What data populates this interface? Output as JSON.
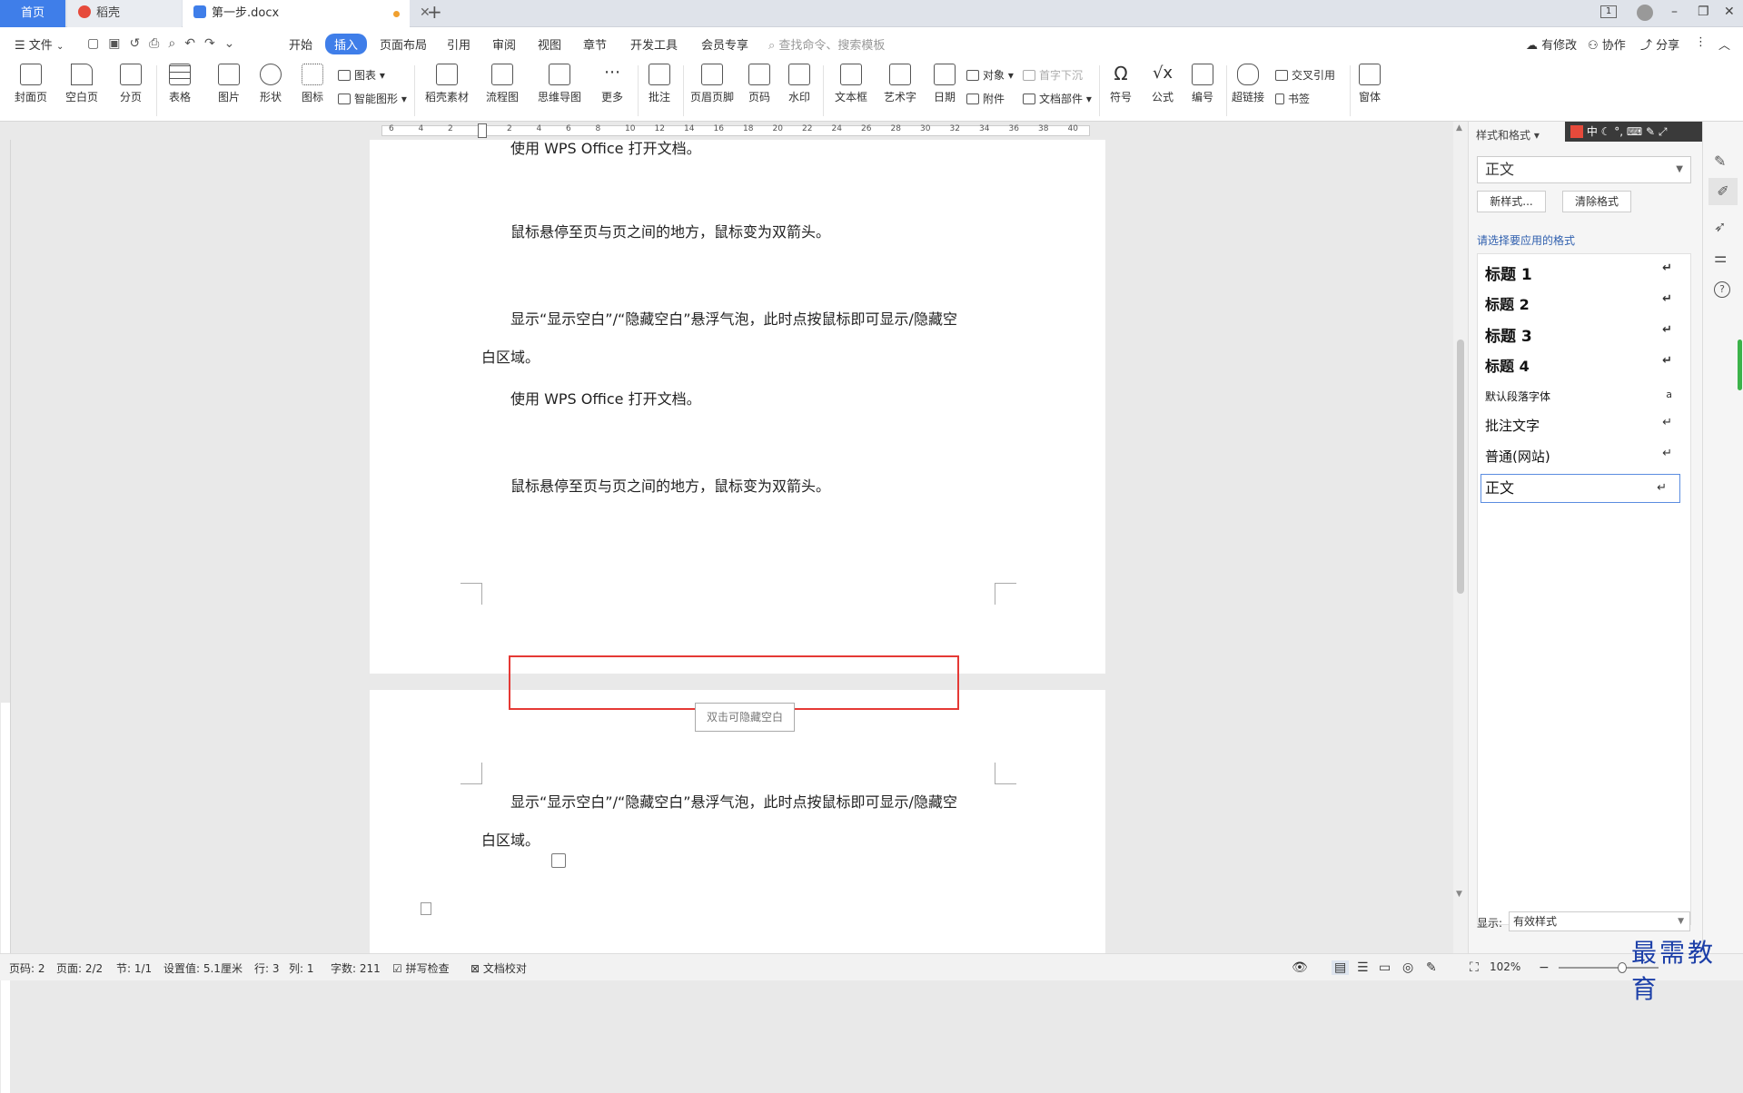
{
  "tabs": {
    "home": "首页",
    "daoke": "稻壳",
    "doc": "第一步.docx",
    "new_tab": "+"
  },
  "window": {
    "layout_btn": "1",
    "minimize": "–",
    "restore": "❐",
    "close": "✕"
  },
  "menu": {
    "file": "文件",
    "items": [
      "开始",
      "插入",
      "页面布局",
      "引用",
      "审阅",
      "视图",
      "章节",
      "开发工具",
      "会员专享"
    ],
    "search_placeholder": "查找命令、搜索模板",
    "modify": "有修改",
    "collab": "协作",
    "share": "分享"
  },
  "ribbon": {
    "big": [
      "封面页",
      "空白页",
      "分页",
      "表格",
      "图片",
      "形状",
      "图标",
      "稻壳素材",
      "流程图",
      "思维导图",
      "更多",
      "批注",
      "页眉页脚",
      "页码",
      "水印",
      "文本框",
      "艺术字",
      "日期",
      "符号",
      "公式",
      "编号",
      "超链接",
      "窗体"
    ],
    "small": {
      "chart": "图表",
      "smart": "智能图形",
      "object": "对象",
      "attach": "附件",
      "dropcap": "首字下沉",
      "docpart": "文档部件",
      "crossref": "交叉引用",
      "bookmark": "书签"
    }
  },
  "ruler_ticks": [
    "6",
    "4",
    "2",
    "",
    "2",
    "4",
    "6",
    "8",
    "10",
    "12",
    "14",
    "16",
    "18",
    "20",
    "22",
    "24",
    "26",
    "28",
    "30",
    "32",
    "34",
    "36",
    "38",
    "40"
  ],
  "doc": {
    "p0": "使用 WPS Office 打开文档。",
    "p1": "鼠标悬停至页与页之间的地方，鼠标变为双箭头。",
    "p2a": "显示“显示空白”/“隐藏空白”悬浮气泡，此时点按鼠标即可显示/隐藏空",
    "p2b": "白区域。",
    "p3": "使用 WPS Office 打开文档。",
    "p4": "鼠标悬停至页与页之间的地方，鼠标变为双箭头。",
    "tooltip": "双击可隐藏空白",
    "p5a": "显示“显示空白”/“隐藏空白”悬浮气泡，此时点按鼠标即可显示/隐藏空",
    "p5b": "白区域。"
  },
  "panel": {
    "title": "样式和格式",
    "current": "正文",
    "new_style": "新样式...",
    "clear_format": "清除格式",
    "hint": "请选择要应用的格式",
    "styles": [
      "标题  1",
      "标题  2",
      "标题  3",
      "标题  4",
      "默认段落字体",
      "批注文字",
      "普通(网站)",
      "正文"
    ],
    "show_label": "显示:",
    "show_value": "有效样式"
  },
  "ime": {
    "zh": "中"
  },
  "status": {
    "page_num": "页码: 2",
    "pages": "页面: 2/2",
    "section": "节: 1/1",
    "setting": "设置值: 5.1厘米",
    "row": "行: 3",
    "col": "列: 1",
    "words": "字数: 211",
    "spell": "拼写检查",
    "proof": "文档校对",
    "zoom": "102%"
  },
  "watermark": "最需教育",
  "colors": {
    "accent": "#3f7ee9",
    "highlight_box": "#e53935",
    "watermark": "#1c3fa8"
  }
}
